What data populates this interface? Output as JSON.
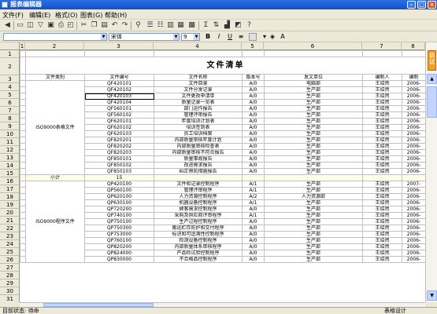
{
  "window": {
    "title": "报表编辑器",
    "controls": {
      "minimize": "–",
      "maximize": "□",
      "close": "×"
    }
  },
  "menu": [
    "文件(F)",
    "编辑(E)",
    "格式(O)",
    "图表(G)",
    "帮助(H)"
  ],
  "toolbar": {
    "icons": [
      "back-icon",
      "new-icon",
      "open-icon",
      "filter-icon",
      "save-icon",
      "print-icon",
      "print-preview-icon",
      "cut-icon",
      "copy-icon",
      "paste-icon",
      "undo-icon",
      "redo-icon",
      "find-icon",
      "insert-row-icon",
      "delete-row-icon",
      "insert-col-icon",
      "delete-col-icon",
      "merge-icon",
      "sum-icon",
      "sort-icon",
      "chart-icon",
      "image-icon",
      "help-icon"
    ]
  },
  "format_bar": {
    "cell_ref": "",
    "font": "宋体",
    "size": "9",
    "bold": "B",
    "italic": "I",
    "underline": "U",
    "align_menu": "≡"
  },
  "columns": [
    "1",
    "2",
    "3",
    "4",
    "5",
    "6",
    "7",
    "8"
  ],
  "rows": [
    "1",
    "2",
    "3",
    "4",
    "5",
    "6",
    "7",
    "8",
    "9",
    "10",
    "11",
    "12",
    "13",
    "14",
    "15",
    "16",
    "17",
    "18",
    "19",
    "20",
    "21",
    "22",
    "23",
    "24",
    "25",
    "26",
    "27",
    "28",
    "29",
    "30",
    "31",
    "32"
  ],
  "sheet": {
    "title": "文件清单",
    "header": [
      "文件类别",
      "文件编号",
      "文件名称",
      "版本号",
      "发文单位",
      "编制人",
      "编制"
    ],
    "group1": {
      "category": "ISO9000表格文件",
      "rows": [
        [
          "QF420101",
          "文件目录",
          "A/0",
          "电脑部",
          "王绍然",
          "2006-"
        ],
        [
          "QF420102",
          "文件分发记录",
          "A/0",
          "生产部",
          "王绍然",
          "2006-"
        ],
        [
          "QF420103",
          "文件更改申请单",
          "A/0",
          "生产部",
          "王绍然",
          "2006-"
        ],
        [
          "QF420104",
          "质量记录一览表",
          "A/0",
          "生产部",
          "王绍然",
          "2006-"
        ],
        [
          "QF560101",
          "部门运作报告",
          "A/0",
          "生产部",
          "王绍然",
          "2006-"
        ],
        [
          "QF560102",
          "管理评审报告",
          "A/0",
          "生产部",
          "王绍然",
          "2006-"
        ],
        [
          "QF620101",
          "年度培训计划表",
          "A/0",
          "生产部",
          "王绍然",
          "2006-"
        ],
        [
          "QF620102",
          "培训签到表",
          "A/0",
          "生产部",
          "王绍然",
          "2006-"
        ],
        [
          "QF620103",
          "员工培训档案",
          "A/0",
          "生产部",
          "王绍然",
          "2006-"
        ],
        [
          "QF820201",
          "内部质量审核年度计划",
          "A/0",
          "生产部",
          "王绍然",
          "2006-"
        ],
        [
          "QF820202",
          "内部质量审核检查表",
          "A/0",
          "生产部",
          "王绍然",
          "2006-"
        ],
        [
          "QF820203",
          "内部质量审核不符合报告",
          "A/0",
          "生产部",
          "王绍然",
          "2006-"
        ],
        [
          "QF850101",
          "质量事故报告",
          "A/0",
          "生产部",
          "王绍然",
          "2006-"
        ],
        [
          "QF850102",
          "改进需求报告",
          "A/0",
          "生产部",
          "王绍然",
          "2006-"
        ],
        [
          "QF850103",
          "纠正预防措施报告",
          "A/0",
          "生产部",
          "王绍然",
          "2006-"
        ]
      ]
    },
    "subtotal": {
      "label": "小计",
      "value": "15"
    },
    "group2": {
      "category": "ISO9000程序文件",
      "rows": [
        [
          "QP420100",
          "文件和记录控制程序",
          "A/1",
          "生产部",
          "王绍然",
          "2007-"
        ],
        [
          "QP560100",
          "管理评审程序",
          "A/1",
          "生产部",
          "王绍然",
          "2006-"
        ],
        [
          "QP620100",
          "人力资源控制程序",
          "A/2",
          "人力资源部",
          "王绍然",
          "2006-"
        ],
        [
          "QP630100",
          "机器设备控制程序",
          "A/1",
          "生产部",
          "王绍然",
          "2006-"
        ],
        [
          "QP720200",
          "顾客需求控制程序",
          "A/0",
          "生产部",
          "王绍然",
          "2006-"
        ],
        [
          "QP740100",
          "采购及供应商评审程序",
          "A/1",
          "生产部",
          "王绍然",
          "2006-"
        ],
        [
          "QP750100",
          "生产过程控制程序",
          "A/0",
          "生产部",
          "王绍然",
          "2006-"
        ],
        [
          "QP750300",
          "搬运贮存防护和交付程序",
          "A/0",
          "生产部",
          "王绍然",
          "2006-"
        ],
        [
          "QP753000",
          "标识和可追溯性控制程序",
          "A/0",
          "生产部",
          "王绍然",
          "2006-"
        ],
        [
          "QP760100",
          "检测设备控制程序",
          "A/0",
          "生产部",
          "王绍然",
          "2006-"
        ],
        [
          "QP820200",
          "内部质量体系审核程序",
          "A/0",
          "生产部",
          "王绍然",
          "2006-"
        ],
        [
          "QP824000",
          "产品检试验控制程序",
          "A/0",
          "生产部",
          "王绍然",
          "2006-"
        ],
        [
          "QP830000",
          "不合格品控制程序",
          "A/0",
          "生产部",
          "王绍然",
          "2006-"
        ]
      ]
    }
  },
  "side_tab": "调试",
  "status": {
    "left": "目前状态: 待命",
    "right": "表格设计"
  }
}
